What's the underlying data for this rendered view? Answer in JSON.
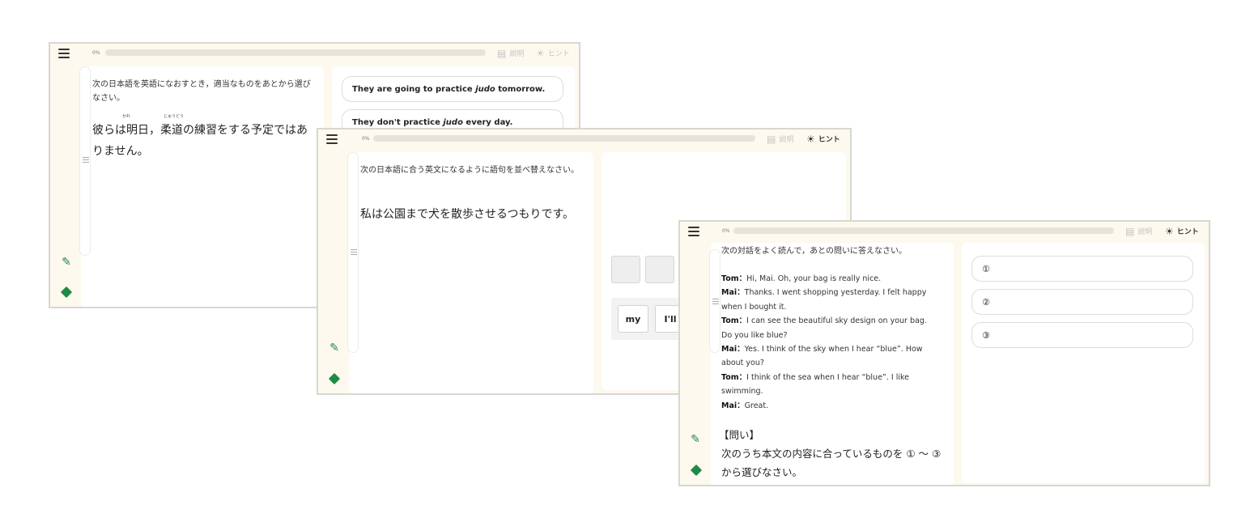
{
  "toolbar": {
    "percent": "0%",
    "explain_label": "説明",
    "hint_label": "ヒント"
  },
  "screen1": {
    "instruction": "次の日本語を英語になおすとき，適当なものをあとから選びなさい。",
    "sentence_before": "彼らは明日，",
    "ruby_kare": "かれ",
    "kanji_ju": "柔",
    "ruby_judo": "じゅうどう",
    "sentence_mid": "道",
    "sentence_after": "の練習をする予定ではありません。",
    "choices": [
      {
        "before": "They are going to practice ",
        "em": "judo",
        "after": " tomorrow."
      },
      {
        "before": "They don't practice ",
        "em": "judo",
        "after": " every day."
      }
    ]
  },
  "screen2": {
    "instruction": "次の日本語に合う英文になるように語句を並べ替えなさい。",
    "sentence": "私は公園まで犬を散歩させるつもりです。",
    "tiles": [
      "my",
      "I'll"
    ]
  },
  "screen3": {
    "instruction": "次の対話をよく読んで，あとの問いに答えなさい。",
    "dialog": [
      {
        "speaker": "Tom",
        "sep": "：",
        "text": "Hi, Mai. Oh, your bag is really nice."
      },
      {
        "speaker": "Mai",
        "sep": "：",
        "text": "Thanks. I went shopping yesterday. I felt happy when I bought it."
      },
      {
        "speaker": "Tom",
        "sep": "：",
        "text": "I can see the beautiful sky design on your bag. Do you like blue?"
      },
      {
        "speaker": "Mai",
        "sep": "：",
        "text": "Yes. I think of the sky when I hear “blue”. How about you?"
      },
      {
        "speaker": "Tom",
        "sep": "：",
        "text": "I think of the sea when I hear “blue”. I like swimming."
      },
      {
        "speaker": "Mai",
        "sep": "：",
        "text": "Great."
      }
    ],
    "question_label": "【問い】",
    "question": "次のうち本文の内容に合っているものを ① ～ ③ から選びなさい。",
    "choices": [
      "①",
      "②",
      "③"
    ]
  },
  "colors": {
    "background": "#fdf9ee",
    "accent_green": "#1e8a45",
    "border": "#d7d7d2"
  },
  "icons": [
    "menu-icon",
    "explain-icon",
    "hint-bulb-icon",
    "pencil-icon",
    "eraser-icon"
  ]
}
